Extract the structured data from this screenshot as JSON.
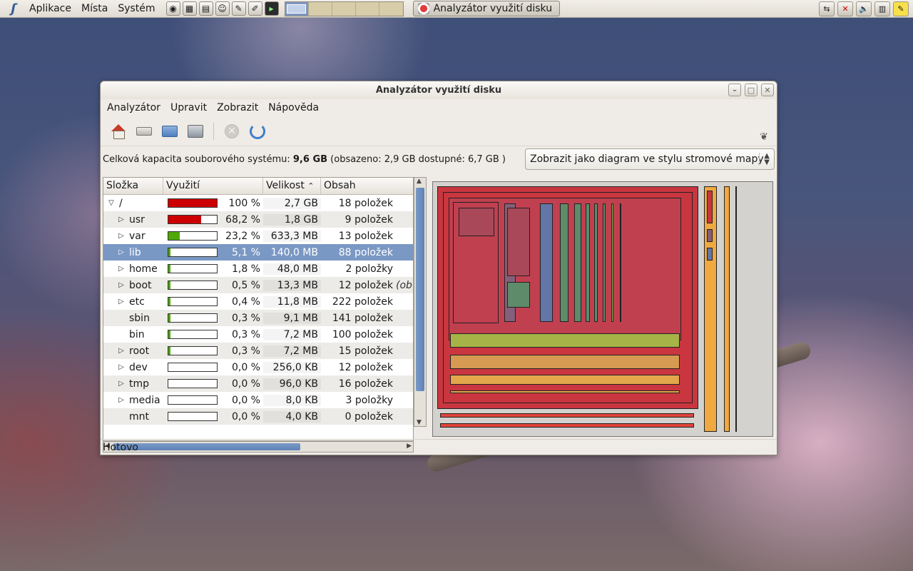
{
  "panel": {
    "menus": [
      "Aplikace",
      "Místa",
      "Systém"
    ],
    "launchers": [
      "firefox-icon",
      "network-icon",
      "document-icon",
      "people-icon",
      "text-editor-icon",
      "notes-icon",
      "terminal-icon"
    ],
    "task_label": "Analyzátor využití disku",
    "tray_icons": [
      "network-manager-icon",
      "network-disconnected-icon",
      "volume-icon",
      "clipboard-icon",
      "sticky-notes-icon"
    ]
  },
  "window": {
    "title": "Analyzátor využití disku",
    "menu": [
      "Analyzátor",
      "Upravit",
      "Zobrazit",
      "Nápověda"
    ],
    "info": {
      "prefix": "Celková kapacita souborového systému: ",
      "total": "9,6 GB",
      "suffix": " (obsazeno: 2,9 GB dostupné: 6,7 GB )"
    },
    "view_combo": "Zobrazit jako diagram ve stylu stromové mapy",
    "columns": [
      "Složka",
      "Využití",
      "Velikost",
      "Obsah"
    ],
    "status": "Hotovo",
    "colors": {
      "high": "#cc0000",
      "medium": "#4ea80a",
      "low": "#4ea80a"
    },
    "rows": [
      {
        "name": "/",
        "usage": 100,
        "pct": "100 %",
        "size": "2,7 GB",
        "contents": "18 položek",
        "expander": "open",
        "extra": ""
      },
      {
        "name": "usr",
        "usage": 68.2,
        "pct": "68,2 %",
        "size": "1,8 GB",
        "contents": "9 položek",
        "expander": "closed",
        "extra": ""
      },
      {
        "name": "var",
        "usage": 23.2,
        "pct": "23,2 %",
        "size": "633,3 MB",
        "contents": "13 položek",
        "expander": "closed",
        "extra": ""
      },
      {
        "name": "lib",
        "usage": 5.1,
        "pct": "5,1 %",
        "size": "140,0 MB",
        "contents": "88 položek",
        "expander": "closed",
        "extra": "",
        "selected": true
      },
      {
        "name": "home",
        "usage": 1.8,
        "pct": "1,8 %",
        "size": "48,0 MB",
        "contents": "2 položky",
        "expander": "closed",
        "extra": ""
      },
      {
        "name": "boot",
        "usage": 0.5,
        "pct": "0,5 %",
        "size": "13,3 MB",
        "contents": "12 položek",
        "expander": "closed",
        "extra": "(ob"
      },
      {
        "name": "etc",
        "usage": 0.4,
        "pct": "0,4 %",
        "size": "11,8 MB",
        "contents": "222 položek",
        "expander": "closed",
        "extra": ""
      },
      {
        "name": "sbin",
        "usage": 0.3,
        "pct": "0,3 %",
        "size": "9,1 MB",
        "contents": "141 položek",
        "expander": "none",
        "extra": ""
      },
      {
        "name": "bin",
        "usage": 0.3,
        "pct": "0,3 %",
        "size": "7,2 MB",
        "contents": "100 položek",
        "expander": "none",
        "extra": ""
      },
      {
        "name": "root",
        "usage": 0.3,
        "pct": "0,3 %",
        "size": "7,2 MB",
        "contents": "15 položek",
        "expander": "closed",
        "extra": ""
      },
      {
        "name": "dev",
        "usage": 0.0,
        "pct": "0,0 %",
        "size": "256,0 KB",
        "contents": "12 položek",
        "expander": "closed",
        "extra": ""
      },
      {
        "name": "tmp",
        "usage": 0.0,
        "pct": "0,0 %",
        "size": "96,0 KB",
        "contents": "16 položek",
        "expander": "closed",
        "extra": ""
      },
      {
        "name": "media",
        "usage": 0.0,
        "pct": "0,0 %",
        "size": "8,0 KB",
        "contents": "3 položky",
        "expander": "closed",
        "extra": ""
      },
      {
        "name": "mnt",
        "usage": 0.0,
        "pct": "0,0 %",
        "size": "4,0 KB",
        "contents": "0 položek",
        "expander": "none",
        "extra": ""
      }
    ]
  }
}
